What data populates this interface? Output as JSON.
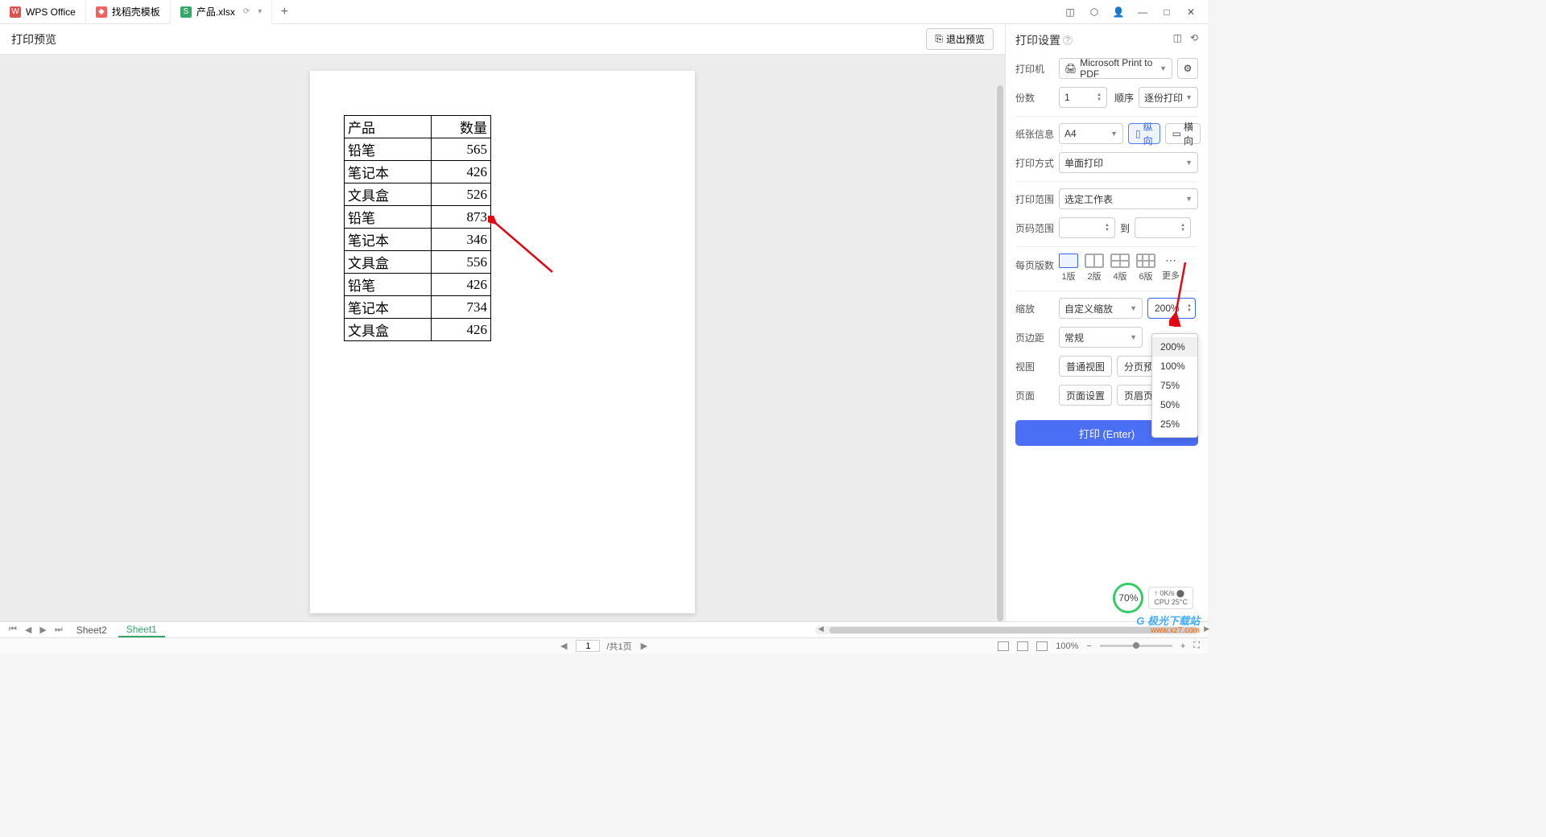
{
  "tabs": [
    {
      "icon": "W",
      "label": "WPS Office"
    },
    {
      "icon": "D",
      "label": "找稻壳模板"
    },
    {
      "icon": "S",
      "label": "产品.xlsx"
    }
  ],
  "preview": {
    "title": "打印预览",
    "exit": "退出预览"
  },
  "table": {
    "header": [
      "产品",
      "数量"
    ],
    "rows": [
      [
        "铅笔",
        "565"
      ],
      [
        "笔记本",
        "426"
      ],
      [
        "文具盒",
        "526"
      ],
      [
        "铅笔",
        "873"
      ],
      [
        "笔记本",
        "346"
      ],
      [
        "文具盒",
        "556"
      ],
      [
        "铅笔",
        "426"
      ],
      [
        "笔记本",
        "734"
      ],
      [
        "文具盒",
        "426"
      ]
    ]
  },
  "settings": {
    "title": "打印设置",
    "printer_label": "打印机",
    "printer_value": "Microsoft Print to PDF",
    "copies_label": "份数",
    "copies_value": "1",
    "order_label": "顺序",
    "order_value": "逐份打印",
    "paper_label": "纸张信息",
    "paper_value": "A4",
    "portrait": "纵向",
    "landscape": "横向",
    "method_label": "打印方式",
    "method_value": "单面打印",
    "range_label": "打印范围",
    "range_value": "选定工作表",
    "pagerange_label": "页码范围",
    "pagerange_to": "到",
    "perpage_label": "每页版数",
    "layout1": "1版",
    "layout2": "2版",
    "layout4": "4版",
    "layout6": "6版",
    "layout_more": "更多",
    "zoom_label": "缩放",
    "zoom_mode": "自定义缩放",
    "zoom_value": "200%",
    "zoom_options": [
      "200%",
      "100%",
      "75%",
      "50%",
      "25%"
    ],
    "margin_label": "页边距",
    "margin_value": "常规",
    "view_label": "视图",
    "view_normal": "普通视图",
    "view_page": "分页预览",
    "page_label": "页面",
    "page_setup": "页面设置",
    "page_hf": "页眉页脚",
    "print_btn": "打印 (Enter)"
  },
  "sheets": {
    "tabs": [
      "Sheet2",
      "Sheet1"
    ],
    "active": 1
  },
  "statusbar": {
    "page_input": "1",
    "page_total": "/共1页",
    "zoom": "100%"
  },
  "perf": {
    "pct": "70%",
    "net": "0K/s",
    "cpu": "CPU 25°C"
  },
  "brand": {
    "l1": "极光下载站",
    "l2": "www.xz7.com"
  }
}
